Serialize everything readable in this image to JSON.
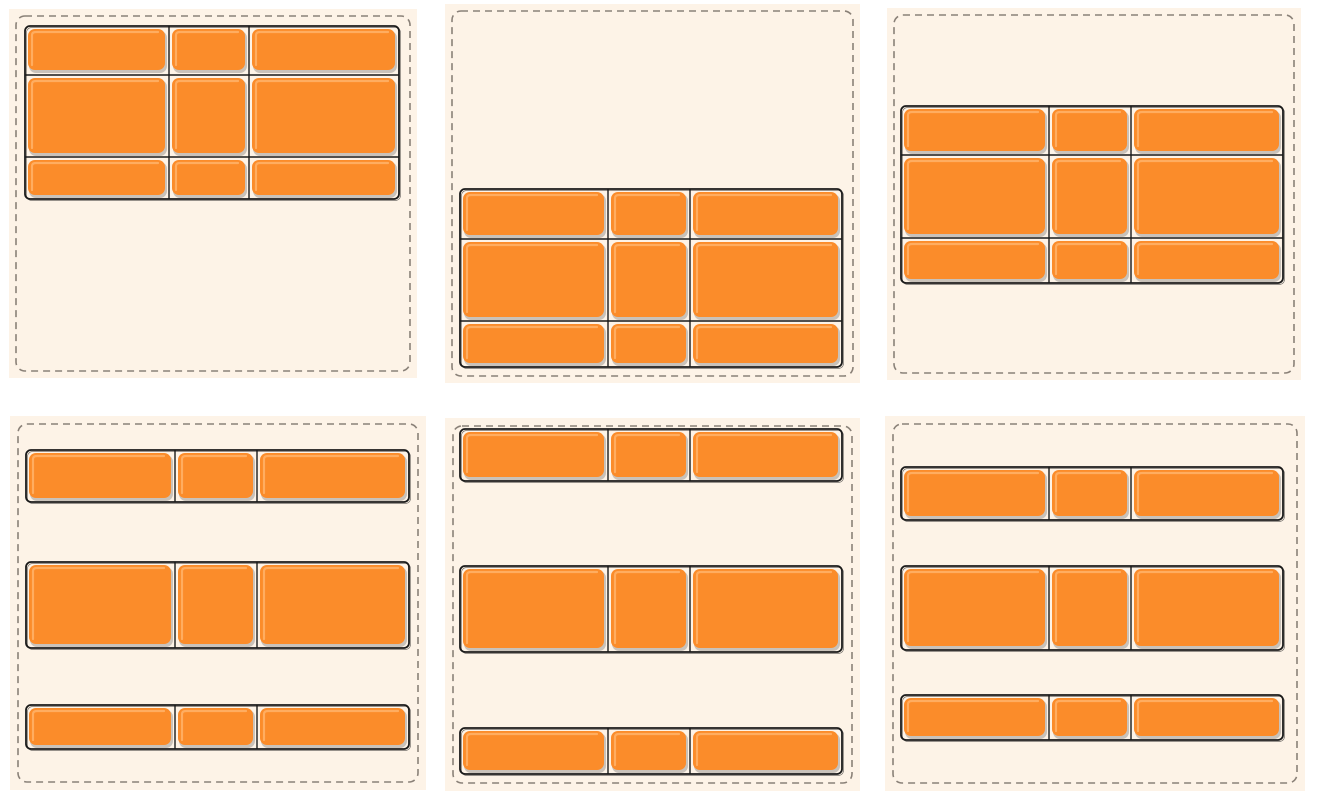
{
  "colors": {
    "page_background": "#ffffff",
    "panel_background": "#fdf3e7",
    "panel_dash_border": "#8a8178",
    "grid_line": "#1a1a1a",
    "cell_fill": "#fb8c2a",
    "cell_highlight": "#ffb36a",
    "cell_shadow": "#c9c2ba"
  },
  "diagram": {
    "type": "css-grid-alignment-illustration",
    "grid": {
      "columns": 3,
      "rows": 3,
      "column_ratio": [
        "wide",
        "narrow",
        "wide"
      ],
      "row_ratio": [
        "short",
        "tall",
        "short"
      ]
    },
    "panels": [
      {
        "id": "start",
        "vertical_alignment": "start"
      },
      {
        "id": "end",
        "vertical_alignment": "end"
      },
      {
        "id": "center",
        "vertical_alignment": "center"
      },
      {
        "id": "space-around",
        "vertical_alignment": "space-around"
      },
      {
        "id": "space-between",
        "vertical_alignment": "space-between"
      },
      {
        "id": "space-evenly",
        "vertical_alignment": "space-evenly"
      }
    ]
  }
}
